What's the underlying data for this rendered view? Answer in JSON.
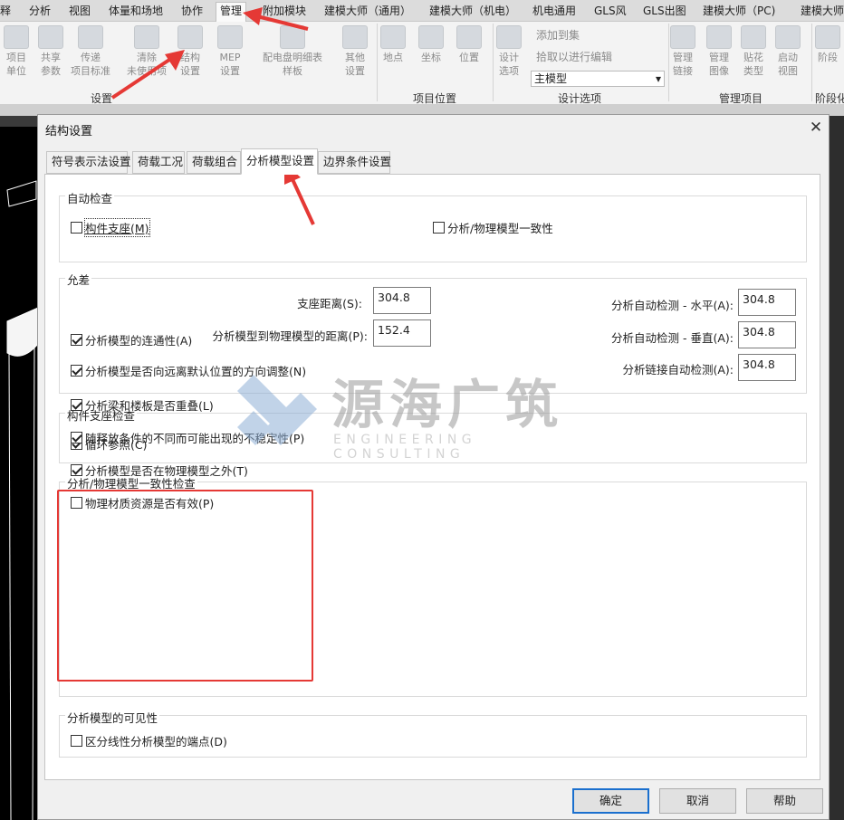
{
  "ribbon": {
    "tabs": [
      "释",
      "分析",
      "视图",
      "体量和场地",
      "协作",
      "管理",
      "附加模块",
      "建模大师（通用）",
      "建模大师（机电）",
      "机电通用",
      "GLS风",
      "GLS出图",
      "建模大师（PC)",
      "建模大师"
    ],
    "active_tab_index": 5,
    "buttons": [
      {
        "label": "项目\n单位",
        "icon": "project-units-icon"
      },
      {
        "label": "共享\n参数",
        "icon": "shared-parameters-icon"
      },
      {
        "label": "传递\n项目标准",
        "icon": "transfer-standards-icon"
      },
      {
        "label": "清除\n未使用项",
        "icon": "purge-unused-icon"
      },
      {
        "label": "结构\n设置",
        "icon": "structural-settings-icon"
      },
      {
        "label": "MEP\n设置",
        "icon": "mep-settings-icon"
      },
      {
        "label": "配电盘明细表\n样板",
        "icon": "panel-schedule-icon"
      },
      {
        "label": "其他\n设置",
        "icon": "wrench-icon"
      },
      {
        "label": "地点",
        "icon": "globe-icon"
      },
      {
        "label": "坐标",
        "icon": "coordinates-icon"
      },
      {
        "label": "位置",
        "icon": "position-icon"
      },
      {
        "label": "设计\n选项",
        "icon": "design-options-icon"
      },
      {
        "label": "管理\n链接",
        "icon": "manage-links-icon"
      },
      {
        "label": "管理\n图像",
        "icon": "manage-images-icon"
      },
      {
        "label": "贴花\n类型",
        "icon": "decal-types-icon"
      },
      {
        "label": "启动\n视图",
        "icon": "starting-view-icon"
      },
      {
        "label": "阶段",
        "icon": "phases-icon"
      }
    ],
    "design_option_actions": [
      "添加到集",
      "拾取以进行编辑"
    ],
    "main_model_select": "主模型",
    "group_labels": [
      "设置",
      "项目位置",
      "设计选项",
      "管理项目",
      "阶段化"
    ]
  },
  "dialog": {
    "title": "结构设置",
    "tabs": [
      "符号表示法设置",
      "荷载工况",
      "荷载组合",
      "分析模型设置",
      "边界条件设置"
    ],
    "active_tab_index": 3,
    "groups": {
      "auto_check": {
        "title": "自动检查",
        "items": [
          {
            "label": "构件支座(M)",
            "checked": false
          },
          {
            "label": "分析/物理模型一致性",
            "checked": false
          }
        ]
      },
      "tolerance": {
        "title": "允差",
        "fields": [
          {
            "label": "支座距离(S):",
            "value": "304.8"
          },
          {
            "label": "分析模型到物理模型的距离(P):",
            "value": "152.4"
          },
          {
            "label": "分析自动检测 - 水平(A):",
            "value": "304.8"
          },
          {
            "label": "分析自动检测 - 垂直(A):",
            "value": "304.8"
          },
          {
            "label": "分析链接自动检测(A):",
            "value": "304.8"
          }
        ]
      },
      "support_check": {
        "title": "构件支座检查",
        "items": [
          {
            "label": "循环参照(C)",
            "checked": true
          }
        ]
      },
      "consistency_check": {
        "title": "分析/物理模型一致性检查",
        "items": [
          {
            "label": "分析模型的连通性(A)",
            "checked": true
          },
          {
            "label": "分析模型是否向远离默认位置的方向调整(N)",
            "checked": true
          },
          {
            "label": "分析梁和楼板是否重叠(L)",
            "checked": true
          },
          {
            "label": "随释放条件的不同而可能出现的不稳定性(P)",
            "checked": true
          },
          {
            "label": "分析模型是否在物理模型之外(T)",
            "checked": true
          },
          {
            "label": "物理材质资源是否有效(P)",
            "checked": false
          }
        ]
      },
      "visibility": {
        "title": "分析模型的可见性",
        "items": [
          {
            "label": "区分线性分析模型的端点(D)",
            "checked": false
          }
        ]
      }
    },
    "buttons": {
      "ok": "确定",
      "cancel": "取消",
      "help": "帮助"
    }
  },
  "watermark": {
    "cn": "源海广筑",
    "en": "ENGINEERING CONSULTING"
  },
  "colors": {
    "annotation_red": "#e53935",
    "default_button_border": "#1a6fce"
  }
}
